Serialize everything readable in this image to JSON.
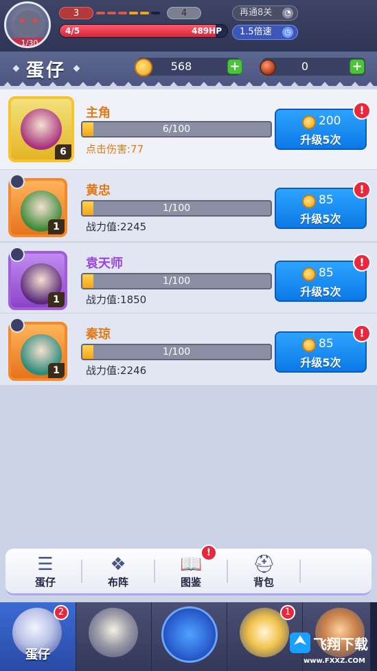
{
  "player": {
    "level": "1/30",
    "wave_current": "3",
    "wave_next": "4",
    "wave_segment_colors": [
      "#d9574a",
      "#d9574a",
      "#d9574a",
      "#f2a51a",
      "#f2a51a",
      "#1c1f33"
    ],
    "lives": "4/5",
    "hp": "489HP",
    "hp_fraction": 0.93,
    "pass_label": "再通8关",
    "speed_label": "1.5倍速"
  },
  "header": {
    "title": "蛋仔",
    "gold": "568",
    "gems": "0"
  },
  "heroes": [
    {
      "name": "主角",
      "name_color": "#e07a18",
      "level": "6",
      "progress": "6/100",
      "progress_fraction": 0.06,
      "stat": "点击伤害:77",
      "stat_color": "#e07a18",
      "cost": "200",
      "upgrade_label": "升级5次",
      "alert": "!",
      "frame": "gold",
      "art_color": "#a8327a"
    },
    {
      "name": "黄忠",
      "name_color": "#e07a18",
      "level": "1",
      "progress": "1/100",
      "progress_fraction": 0.01,
      "stat": "战力值:2245",
      "stat_color": "#2b2d3a",
      "cost": "85",
      "upgrade_label": "升级5次",
      "alert": "!",
      "frame": "orange",
      "art_color": "#3f8a3a"
    },
    {
      "name": "袁天师",
      "name_color": "#9b45d8",
      "level": "1",
      "progress": "1/100",
      "progress_fraction": 0.01,
      "stat": "战力值:1850",
      "stat_color": "#2b2d3a",
      "cost": "85",
      "upgrade_label": "升级5次",
      "alert": "!",
      "frame": "purple",
      "art_color": "#5a2a7a"
    },
    {
      "name": "秦琼",
      "name_color": "#e07a18",
      "level": "1",
      "progress": "1/100",
      "progress_fraction": 0.01,
      "stat": "战力值:2246",
      "stat_color": "#2b2d3a",
      "cost": "85",
      "upgrade_label": "升级5次",
      "alert": "!",
      "frame": "orange",
      "art_color": "#2e8a7a"
    }
  ],
  "submenu": [
    {
      "label": "蛋仔",
      "icon": "list-icon",
      "glyph": "☰"
    },
    {
      "label": "布阵",
      "icon": "formation-icon",
      "glyph": "❖"
    },
    {
      "label": "图鉴",
      "icon": "book-icon",
      "glyph": "📖",
      "alert": "!"
    },
    {
      "label": "背包",
      "icon": "bag-icon",
      "glyph": "⛑"
    }
  ],
  "bottomnav": [
    {
      "label": "蛋仔",
      "badge": "2",
      "icon": "egg-hero-icon"
    },
    {
      "label": "",
      "icon": "knight-egg-icon"
    },
    {
      "label": "",
      "icon": "battle-swords-icon"
    },
    {
      "label": "",
      "badge": "1",
      "icon": "egg-shop-icon"
    },
    {
      "label": "",
      "icon": "reward-icon"
    }
  ],
  "watermark": {
    "logo_text": "飞翔下载",
    "url": "www.FXXZ.COM"
  }
}
